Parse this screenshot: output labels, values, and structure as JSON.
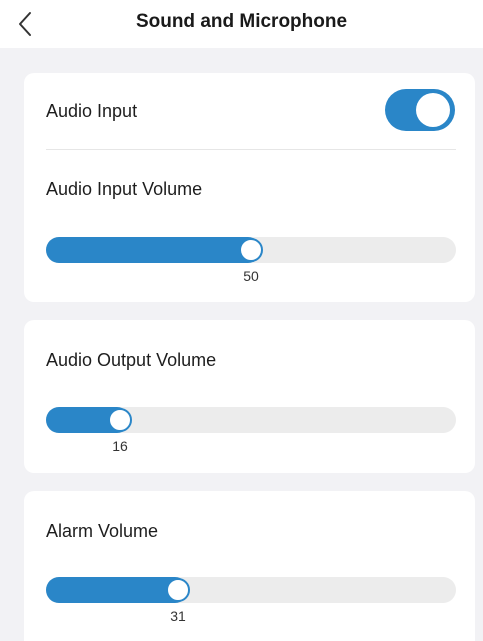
{
  "header": {
    "title": "Sound and Microphone",
    "back_icon": "chevron-left-icon"
  },
  "colors": {
    "accent": "#2a86c8",
    "track": "#ececec",
    "background": "#f2f2f5",
    "card": "#ffffff"
  },
  "audio_input": {
    "label": "Audio Input",
    "enabled": true
  },
  "sliders": [
    {
      "id": "audio-input-volume",
      "label": "Audio Input Volume",
      "value": 50,
      "value_text": "50",
      "min": 0,
      "max": 100
    },
    {
      "id": "audio-output-volume",
      "label": "Audio Output Volume",
      "value": 16,
      "value_text": "16",
      "min": 0,
      "max": 100
    },
    {
      "id": "alarm-volume",
      "label": "Alarm Volume",
      "value": 31,
      "value_text": "31",
      "min": 0,
      "max": 100
    }
  ]
}
